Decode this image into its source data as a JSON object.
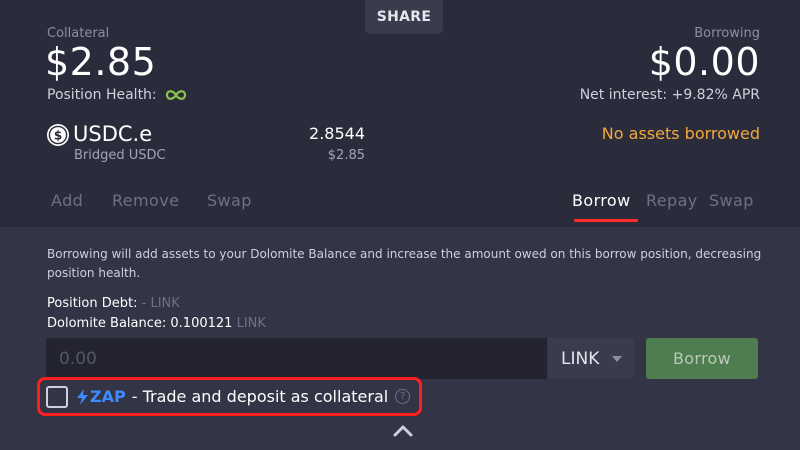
{
  "share_label": "SHARE",
  "collateral": {
    "label": "Collateral",
    "value": "$2.85",
    "health_label": "Position Health:",
    "health_icon": "infinity-icon",
    "health_color": "#8bc34a"
  },
  "borrowing": {
    "label": "Borrowing",
    "value": "$0.00",
    "net_interest": "Net interest: +9.82% APR",
    "no_assets": "No assets borrowed",
    "no_assets_color": "#f2a93b"
  },
  "token": {
    "symbol": "USDC.e",
    "subname": "Bridged USDC",
    "amount": "2.8544",
    "usd": "$2.85",
    "icon": "usdc-coin-icon"
  },
  "tabs_left": [
    "Add",
    "Remove",
    "Swap"
  ],
  "tabs_right": [
    "Borrow",
    "Repay",
    "Swap"
  ],
  "active_tab": "Borrow",
  "info_text": "Borrowing will add assets to your Dolomite Balance and increase the amount owed on this borrow position, decreasing position health.",
  "position_debt": {
    "label": "Position Debt:",
    "value": "-",
    "unit": "LINK"
  },
  "dolomite_balance": {
    "label": "Dolomite Balance:",
    "value": "0.100121",
    "unit": "LINK"
  },
  "input": {
    "placeholder": "0.00",
    "value": ""
  },
  "token_select": {
    "selected": "LINK"
  },
  "borrow_button": "Borrow",
  "zap": {
    "word": "ZAP",
    "text": "- Trade and deposit as collateral",
    "checked": false,
    "accent": "#3d8bff"
  },
  "colors": {
    "highlight": "#ff1f1f",
    "tab_underline": "#ff2a2a",
    "borrow_button_bg": "#4e7d4f"
  }
}
